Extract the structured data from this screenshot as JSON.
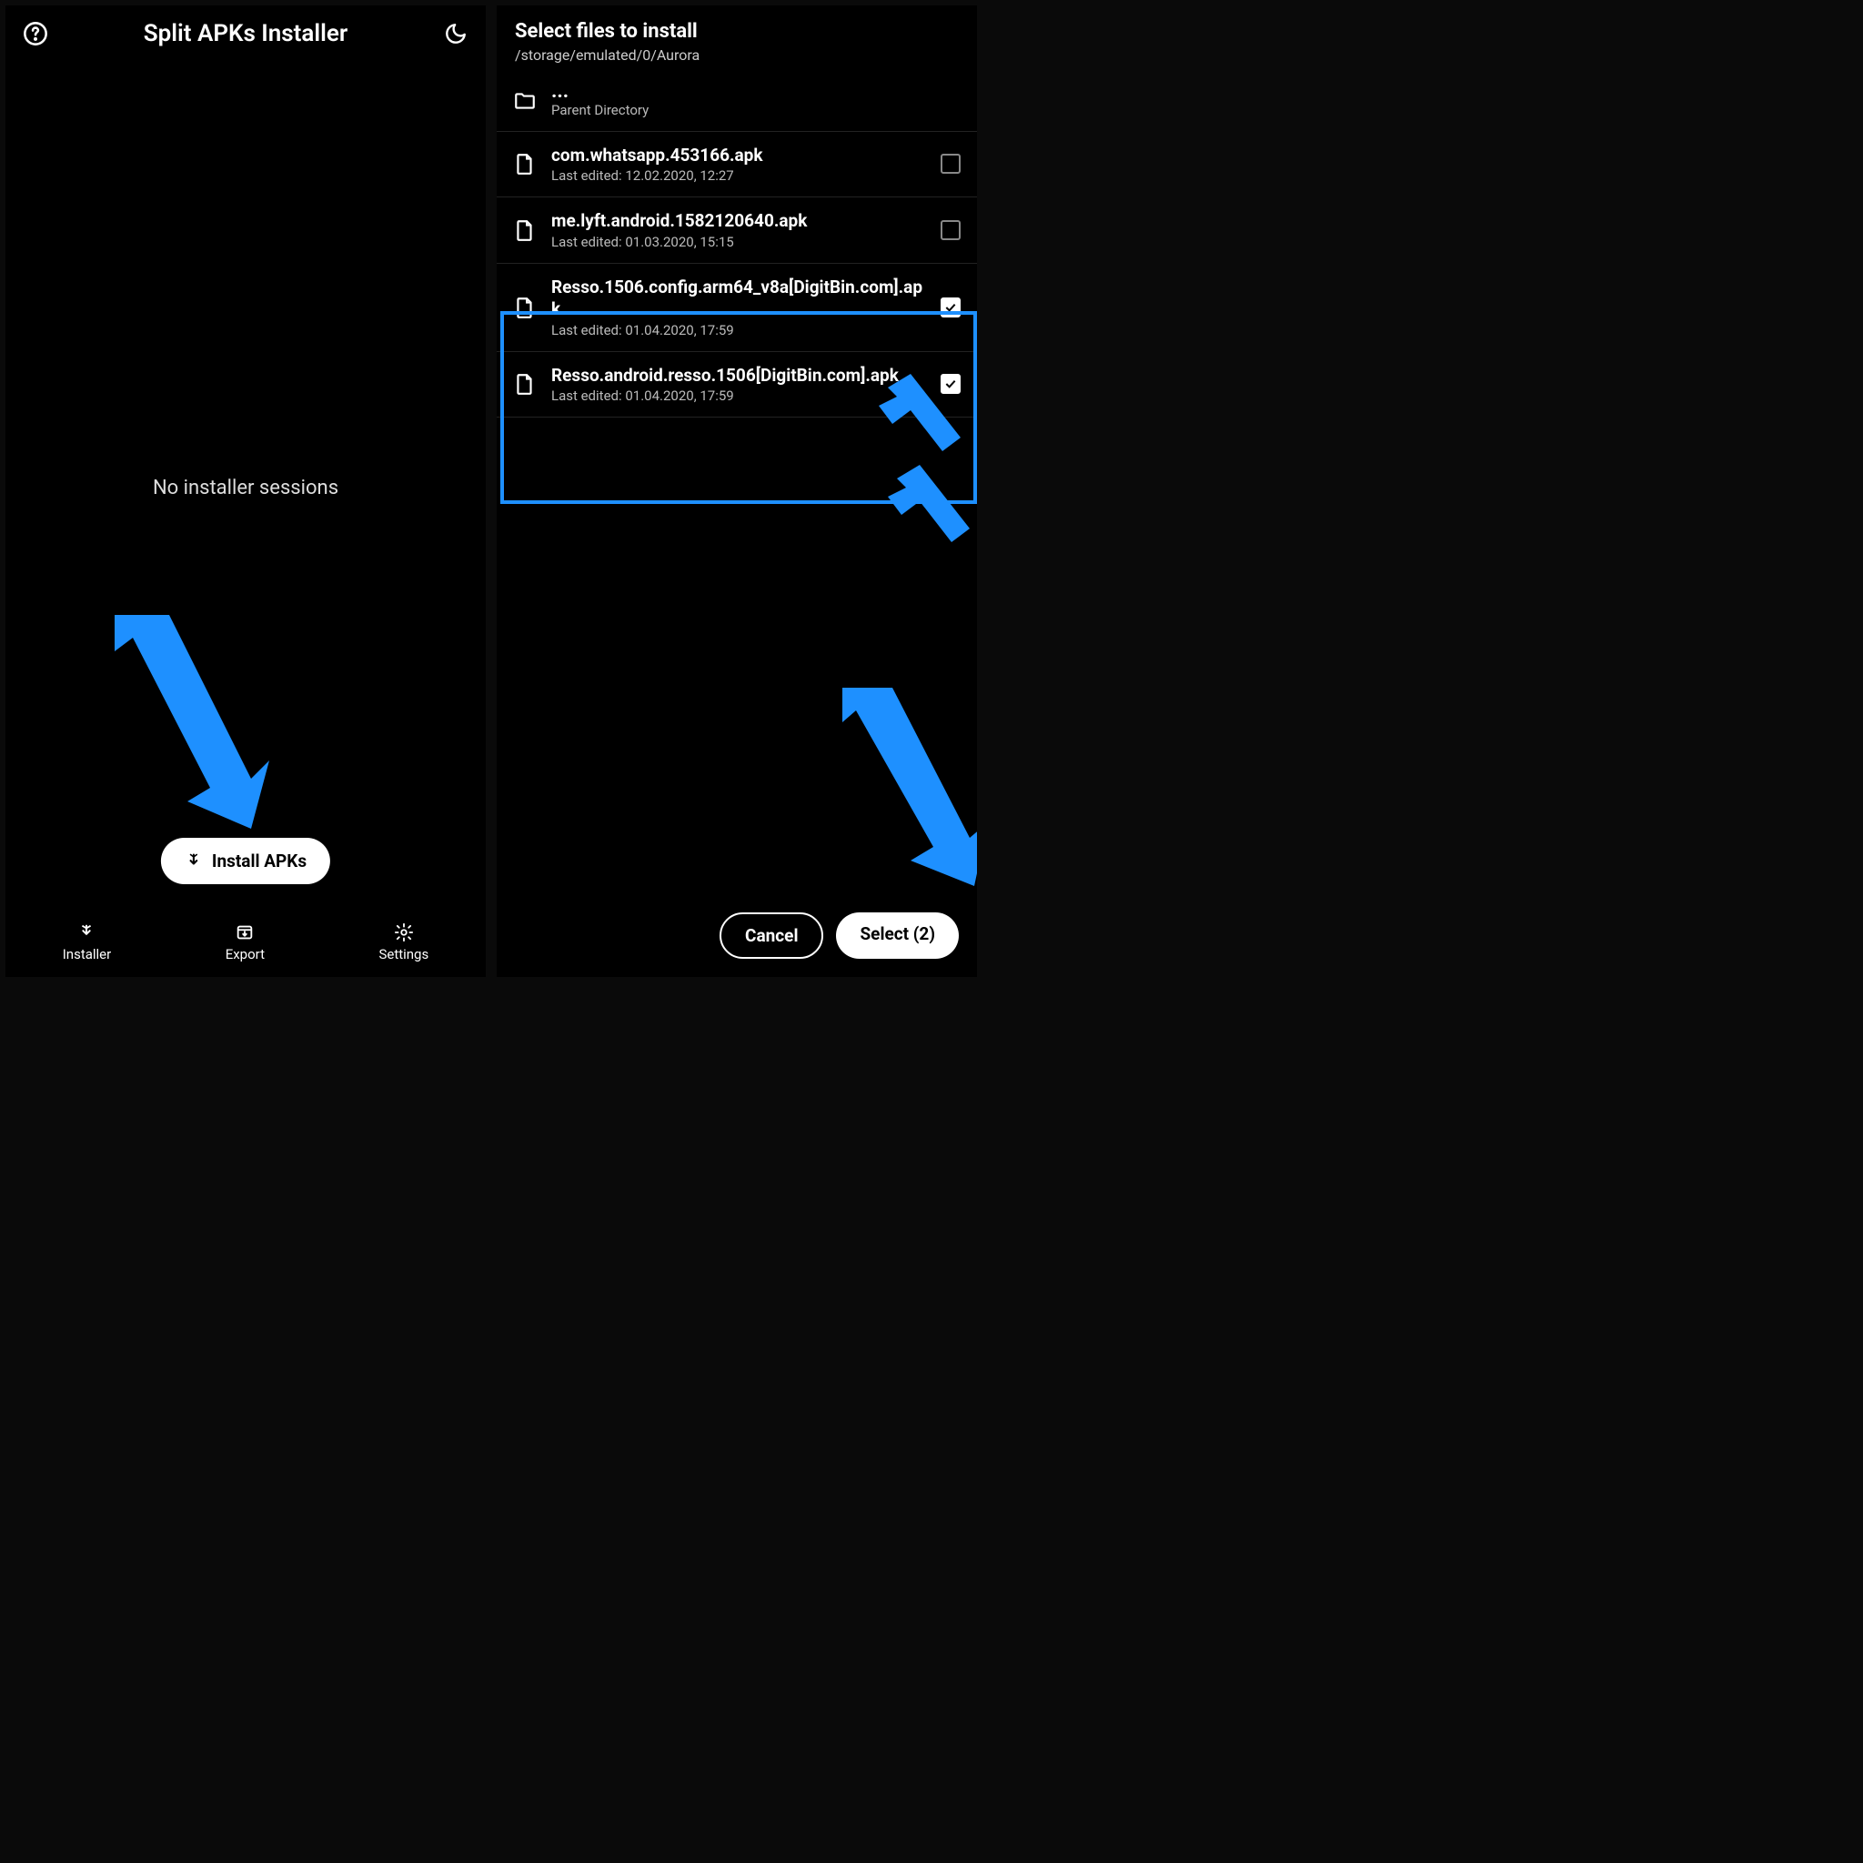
{
  "left": {
    "title": "Split APKs Installer",
    "empty_message": "No installer sessions",
    "install_button": "Install APKs",
    "nav": {
      "installer": "Installer",
      "export": "Export",
      "settings": "Settings"
    }
  },
  "right": {
    "header_title": "Select files to install",
    "header_path": "/storage/emulated/0/Aurora",
    "parent_dots": "...",
    "parent_label": "Parent Directory",
    "files": [
      {
        "name": "com.whatsapp.453166.apk",
        "meta": "Last edited: 12.02.2020, 12:27",
        "checked": false
      },
      {
        "name": "me.lyft.android.1582120640.apk",
        "meta": "Last edited: 01.03.2020, 15:15",
        "checked": false
      },
      {
        "name": "Resso.1506.config.arm64_v8a[DigitBin.com].apk",
        "meta": "Last edited: 01.04.2020, 17:59",
        "checked": true
      },
      {
        "name": "Resso.android.resso.1506[DigitBin.com].apk",
        "meta": "Last edited: 01.04.2020, 17:59",
        "checked": true
      }
    ],
    "cancel": "Cancel",
    "select": "Select (2)"
  },
  "annotations": {
    "arrow_color": "#1e90ff"
  }
}
